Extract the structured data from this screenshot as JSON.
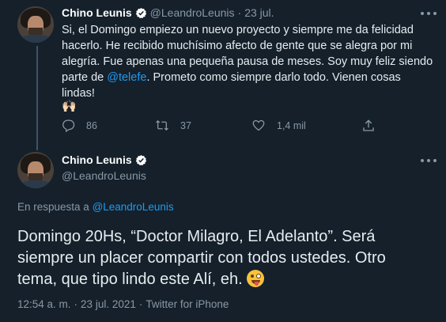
{
  "tweet1": {
    "name": "Chino Leunis",
    "handle": "@LeandroLeunis",
    "separator": "·",
    "date": "23 jul.",
    "text_line1": "Si, el Domingo empiezo un nuevo proyecto y siempre me da felicidad",
    "text_line2": "hacerlo. He recibido muchísimo afecto de gente que se alegra por mi",
    "text_line3": "alegría. Fue apenas una pequeña pausa de meses. Soy muy feliz siendo",
    "text_line4_pre": "parte de ",
    "text_line4_link": "@telefe",
    "text_line4_post": ". Prometo como siempre darlo todo. Vienen cosas lindas!",
    "emoji": "🙌🏻",
    "replies": "86",
    "retweets": "37",
    "likes": "1,4 mil"
  },
  "tweet2": {
    "name": "Chino Leunis",
    "handle": "@LeandroLeunis",
    "reply_prefix": "En respuesta a ",
    "reply_to": "@LeandroLeunis",
    "text_line1": "Domingo 20Hs, “Doctor Milagro, El Adelanto”. Será",
    "text_line2": "siempre un placer compartir con todos ustedes. Otro",
    "text_line3": "tema, que tipo lindo este Alí, eh.",
    "time": "12:54 a. m.",
    "separator": "·",
    "date": "23 jul. 2021",
    "source": "Twitter for iPhone"
  },
  "colors": {
    "background": "#15202b",
    "link": "#1d9bf0",
    "secondary_text": "#8899a6",
    "verified": "#ffffff"
  },
  "icons": {
    "verified": "verified-badge-icon",
    "more": "more-options-icon",
    "reply": "reply-icon",
    "retweet": "retweet-icon",
    "like": "heart-icon",
    "share": "share-icon",
    "emoji_reaction": "winking-face-with-tongue-icon"
  }
}
